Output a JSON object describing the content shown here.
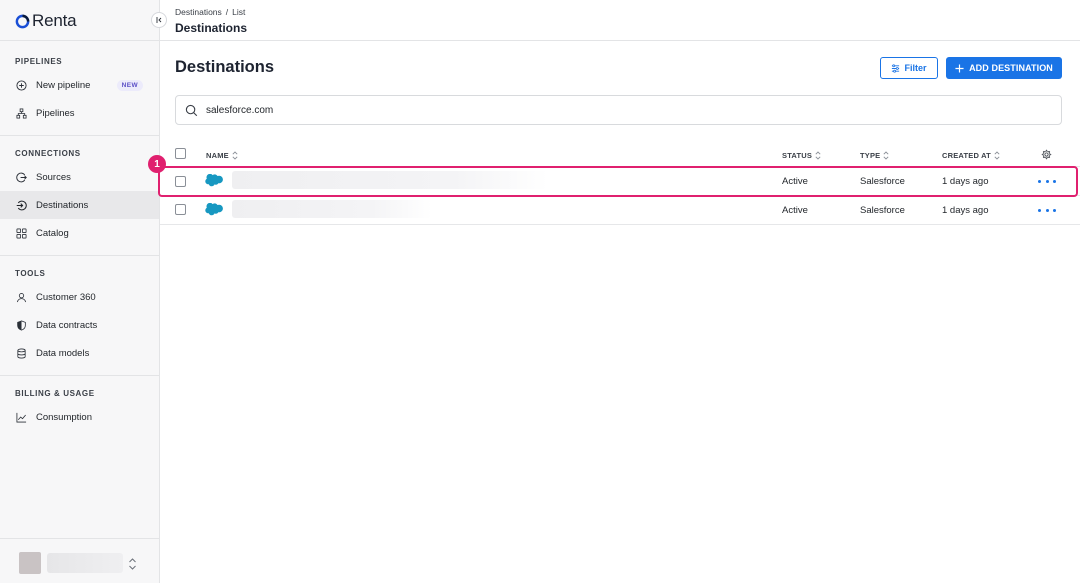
{
  "app": {
    "name": "Renta"
  },
  "sidebar": {
    "sections": [
      {
        "title": "PIPELINES"
      },
      {
        "title": "CONNECTIONS"
      },
      {
        "title": "TOOLS"
      },
      {
        "title": "BILLING & USAGE"
      }
    ],
    "items": [
      {
        "label": "New pipeline",
        "icon": "plus-circle-icon",
        "badge": "NEW"
      },
      {
        "label": "Pipelines",
        "icon": "hierarchy-icon"
      },
      {
        "label": "Sources",
        "icon": "sign-out-icon"
      },
      {
        "label": "Destinations",
        "icon": "sign-in-icon",
        "active": true
      },
      {
        "label": "Catalog",
        "icon": "grid-icon"
      },
      {
        "label": "Customer 360",
        "icon": "user-icon"
      },
      {
        "label": "Data contracts",
        "icon": "shield-icon"
      },
      {
        "label": "Data models",
        "icon": "database-icon"
      },
      {
        "label": "Consumption",
        "icon": "chart-line-icon"
      }
    ]
  },
  "header": {
    "breadcrumb": [
      "Destinations",
      "/",
      "List"
    ],
    "title": "Destinations"
  },
  "main": {
    "title": "Destinations",
    "filter_label": "Filter",
    "add_label": "ADD DESTINATION",
    "search": {
      "value": "salesforce.com",
      "placeholder": "Search"
    }
  },
  "table": {
    "columns": [
      "NAME",
      "STATUS",
      "TYPE",
      "CREATED AT"
    ],
    "rows": [
      {
        "status": "Active",
        "type": "Salesforce",
        "created_at": "1 days ago"
      },
      {
        "status": "Active",
        "type": "Salesforce",
        "created_at": "1 days ago"
      }
    ]
  },
  "annotation": {
    "step": "1"
  },
  "colors": {
    "accent": "#1a74e6",
    "highlight": "#e0206f",
    "salesforce": "#1798c1",
    "new_badge": "#5b4fc7"
  }
}
